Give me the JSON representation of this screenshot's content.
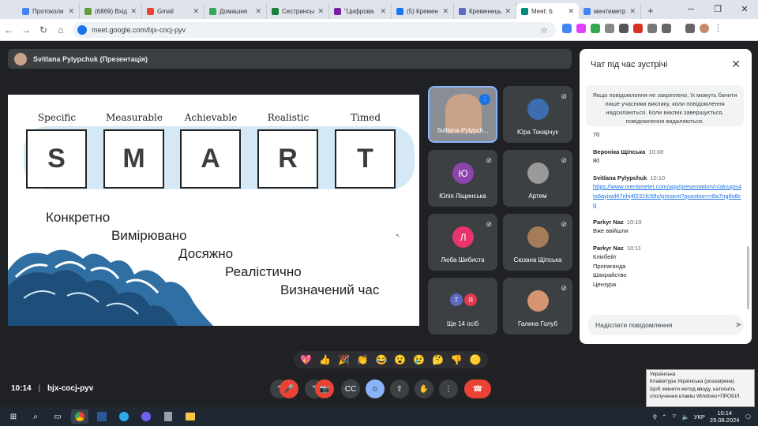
{
  "browser": {
    "tabs": [
      {
        "label": "Протоколи",
        "color": "#4285f4"
      },
      {
        "label": "(6869) Вхід",
        "color": "#5f9c3c"
      },
      {
        "label": "Gmail",
        "color": "#ea4335"
      },
      {
        "label": "Домашня",
        "color": "#34a853"
      },
      {
        "label": "Сестринськ",
        "color": "#188038"
      },
      {
        "label": "\"Цифрова",
        "color": "#7b1fa2"
      },
      {
        "label": "(5) Кремен",
        "color": "#1877f2"
      },
      {
        "label": "Кременець",
        "color": "#5c6bc0"
      },
      {
        "label": "Meet: b",
        "color": "#00897b"
      },
      {
        "label": "ментиметр",
        "color": "#4285f4"
      }
    ],
    "new_tab": "+",
    "url": "meet.google.com/bjx-cocj-pyv"
  },
  "meet": {
    "presenter_label": "Svitlana Pylypchuk (Презентація)",
    "meeting_code": "bjx-cocj-pyv",
    "time": "10:14",
    "separator": "|"
  },
  "slide": {
    "smart_labels": [
      "Specific",
      "Measurable",
      "Achievable",
      "Realistic",
      "Timed"
    ],
    "letters": [
      "S",
      "M",
      "A",
      "R",
      "T"
    ],
    "lines": [
      "Конкретно",
      "Вимірювано",
      "Досяжно",
      "Реалістично",
      "Визначений час"
    ]
  },
  "participants": [
    {
      "name": "Svitlana Pylypch...",
      "initial": "",
      "color": "#c9a28a",
      "mic": "speaking"
    },
    {
      "name": "Юра Токарчук",
      "initial": "",
      "color": "#3b6db0",
      "mic": "muted"
    },
    {
      "name": "Юлія Ліщинська",
      "initial": "Ю",
      "color": "#8e44ad",
      "mic": "muted"
    },
    {
      "name": "Артем",
      "initial": "",
      "color": "#999999",
      "mic": "muted"
    },
    {
      "name": "Люба Шибиста",
      "initial": "Л",
      "color": "#e8336d",
      "mic": "muted"
    },
    {
      "name": "Сюзана Щіпська",
      "initial": "",
      "color": "#a57c5a",
      "mic": "muted"
    },
    {
      "name": "Ще 14 осіб",
      "initial": "",
      "color": "",
      "mic": ""
    },
    {
      "name": "Галина Голуб",
      "initial": "",
      "color": "#d4956f",
      "mic": "muted"
    }
  ],
  "more_initials": [
    "Т",
    "Я"
  ],
  "chat": {
    "title": "Чат під час зустрічі",
    "notice": "Якщо повідомлення не закріплено, їх можуть бачити лише учасники виклику, коли повідомлення надсилаються. Коли виклик завершується, повідомлення видаляються.",
    "messages": [
      {
        "sender": "",
        "time": "",
        "lines": [
          "70"
        ],
        "link": ""
      },
      {
        "sender": "Вероніка Щіпська",
        "time": "10:08",
        "lines": [
          "80"
        ],
        "link": ""
      },
      {
        "sender": "Svitlana Pylypchuk",
        "time": "10:10",
        "lines": [],
        "link": "https://www.mentimeter.com/app/presentation/n/alnupis4tx6ayiwd47nhj4f231fc58s/present?question=r8a7ngifo8cg"
      },
      {
        "sender": "Parkyr Naz",
        "time": "10:10",
        "lines": [
          "Вже ввійшли"
        ],
        "link": ""
      },
      {
        "sender": "Parkyr Naz",
        "time": "10:11",
        "lines": [
          "Клікбейт",
          "Пропаганда",
          "Шахрайство",
          "Цензура"
        ],
        "link": ""
      }
    ],
    "input_placeholder": "Надіслати повідомлення"
  },
  "reactions": [
    "💖",
    "👍",
    "🎉",
    "👏",
    "😂",
    "😮",
    "😢",
    "🤔",
    "👎",
    "🟡"
  ],
  "taskbar": {
    "lang": "УКР",
    "time": "10:14",
    "date": "29.08.2024"
  },
  "tooltip": {
    "line1": "Українська",
    "line2": "Клавіатура Українська (розширена)",
    "line3": "Щоб змінити метод вводу, натисніть сполучення клавіш Windows+ПРОБІЛ."
  },
  "colors": {
    "meet_bg": "#202124",
    "tile_bg": "#3c4043",
    "end_call": "#ea4335",
    "link": "#1a73e8"
  }
}
